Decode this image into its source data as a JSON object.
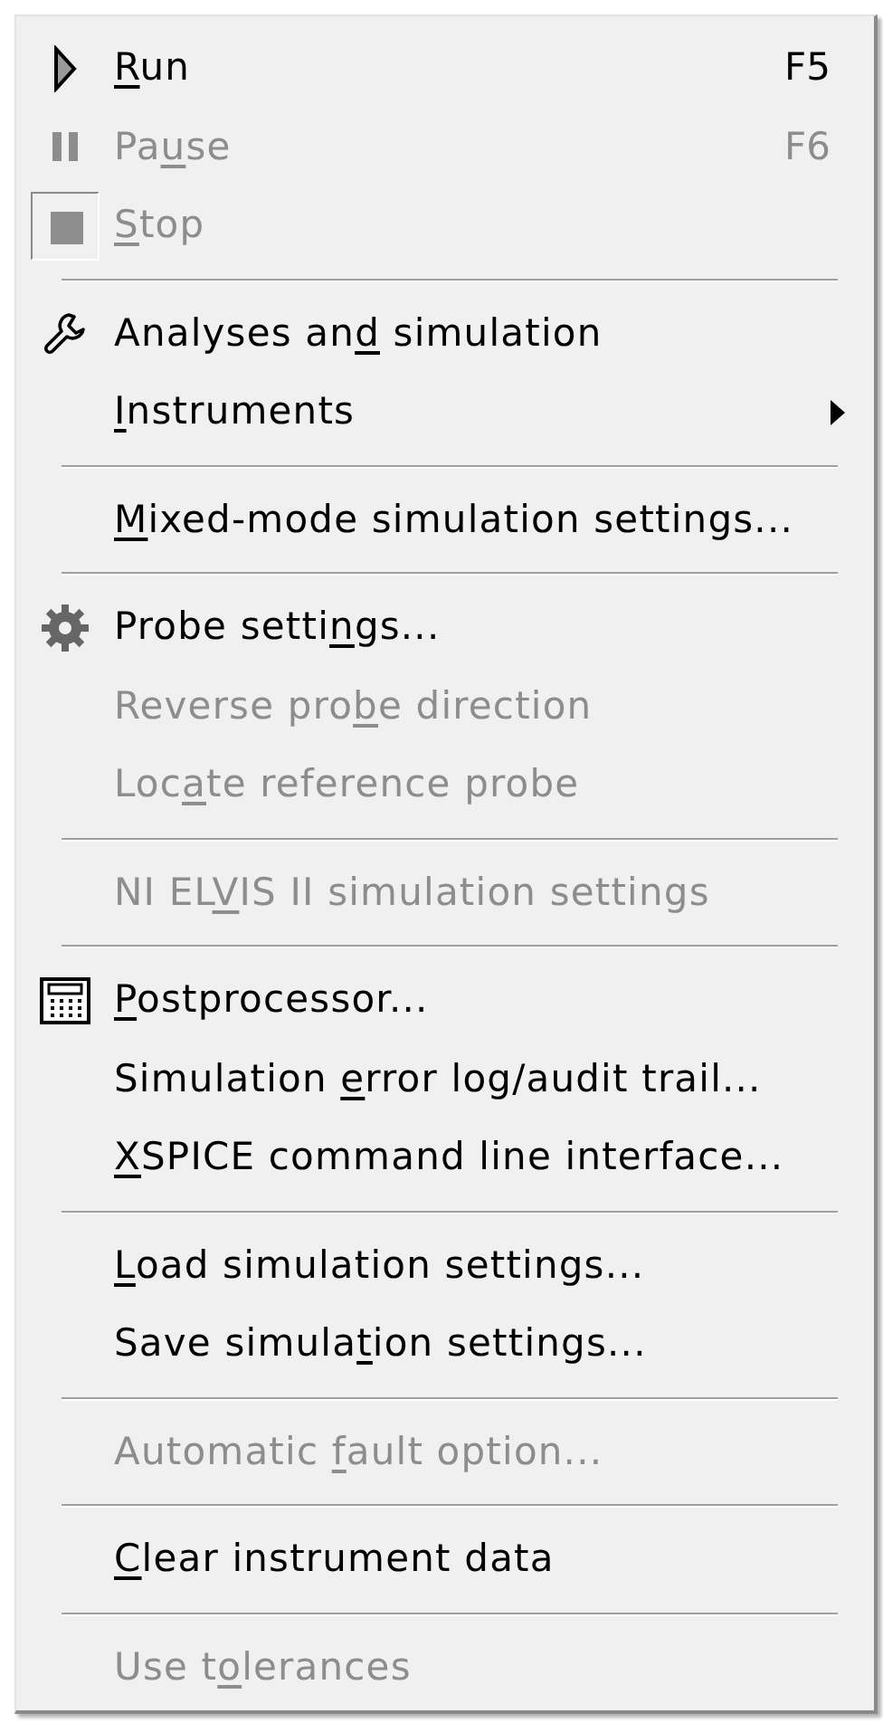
{
  "menu": {
    "entries": [
      {
        "kind": "item",
        "key": "R",
        "after": "un",
        "shortcut": "F5",
        "disabled": false,
        "submenu": false
      },
      {
        "kind": "item",
        "before": "Pa",
        "key": "u",
        "after": "se",
        "shortcut": "F6",
        "disabled": true,
        "submenu": false
      },
      {
        "kind": "item",
        "key": "S",
        "after": "top",
        "disabled": true,
        "submenu": false
      },
      {
        "kind": "separator"
      },
      {
        "kind": "item",
        "before": "Analyses an",
        "key": "d",
        "after": " simulation",
        "disabled": false,
        "submenu": false
      },
      {
        "kind": "item",
        "key": "I",
        "after": "nstruments",
        "disabled": false,
        "submenu": true
      },
      {
        "kind": "separator"
      },
      {
        "kind": "item",
        "key": "M",
        "after": "ixed-mode simulation settings...",
        "disabled": false,
        "submenu": false
      },
      {
        "kind": "separator"
      },
      {
        "kind": "item",
        "before": "Probe setti",
        "key": "n",
        "after": "gs...",
        "disabled": false,
        "submenu": false
      },
      {
        "kind": "item",
        "before": "Reverse pro",
        "key": "b",
        "after": "e direction",
        "disabled": true,
        "submenu": false
      },
      {
        "kind": "item",
        "before": "Loc",
        "key": "a",
        "after": "te reference probe",
        "disabled": true,
        "submenu": false
      },
      {
        "kind": "separator"
      },
      {
        "kind": "item",
        "before": "NI EL",
        "key": "V",
        "after": "IS II simulation settings",
        "disabled": true,
        "submenu": false
      },
      {
        "kind": "separator"
      },
      {
        "kind": "item",
        "key": "P",
        "after": "ostprocessor...",
        "disabled": false,
        "submenu": false
      },
      {
        "kind": "item",
        "before": "Simulation ",
        "key": "e",
        "after": "rror log/audit trail...",
        "disabled": false,
        "submenu": false
      },
      {
        "kind": "item",
        "key": "X",
        "after": "SPICE command line interface...",
        "disabled": false,
        "submenu": false
      },
      {
        "kind": "separator"
      },
      {
        "kind": "item",
        "key": "L",
        "after": "oad simulation settings...",
        "disabled": false,
        "submenu": false
      },
      {
        "kind": "item",
        "before": "Save simula",
        "key": "t",
        "after": "ion settings...",
        "disabled": false,
        "submenu": false
      },
      {
        "kind": "separator"
      },
      {
        "kind": "item",
        "before": "Automatic ",
        "key": "f",
        "after": "ault option...",
        "disabled": true,
        "submenu": false
      },
      {
        "kind": "separator"
      },
      {
        "kind": "item",
        "key": "C",
        "after": "lear instrument data",
        "disabled": false,
        "submenu": false
      },
      {
        "kind": "separator"
      },
      {
        "kind": "item",
        "before": "Use t",
        "key": "o",
        "after": "lerances",
        "disabled": true,
        "submenu": false
      }
    ]
  }
}
